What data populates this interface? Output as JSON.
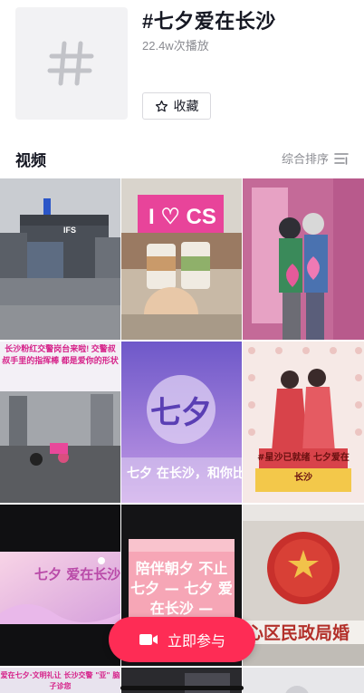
{
  "topic": {
    "title": "#七夕爱在长沙",
    "play_count": "22.4w次播放",
    "favorite_label": "收藏"
  },
  "videos_section": {
    "title": "视频",
    "sort_label": "综合排序"
  },
  "videos": [
    {
      "caption": "IFS",
      "subject": "city building"
    },
    {
      "caption": "I ♡ CS",
      "subject": "milk tea cups"
    },
    {
      "caption": "",
      "subject": "couple with balloons"
    },
    {
      "caption": "长沙粉红交警岗台来啦! 交警叔叔手里的指挥棒 都是爱你的形状",
      "subject": "street traffic"
    },
    {
      "caption": "七夕 在长沙，和你比",
      "subject": "purple qixi graphic"
    },
    {
      "caption": "#星沙已就绪 七夕爱在长沙",
      "subject": "couple illustration"
    },
    {
      "caption": "七夕 爱在长沙",
      "subject": "pink banner"
    },
    {
      "caption": "陪伴朝夕 不止七夕 — 七夕 爱在长沙 —",
      "subject": "pink poster"
    },
    {
      "caption": "心区民政局婚",
      "subject": "civil affairs bureau emblem"
    },
    {
      "caption": "爱在七夕·文明礼让 长沙交警 \"亚\" 脑子诊您",
      "subject": "poster"
    },
    {
      "caption": "",
      "subject": "dark clip"
    },
    {
      "caption": "",
      "subject": "light clip"
    }
  ],
  "join_button": {
    "label": "立即参与"
  },
  "colors": {
    "accent": "#fe2c55",
    "text_primary": "#161823",
    "text_secondary": "#8a8b91"
  },
  "icons": [
    "hashtag-icon",
    "star-outline-icon",
    "sort-filter-icon",
    "video-camera-icon"
  ]
}
